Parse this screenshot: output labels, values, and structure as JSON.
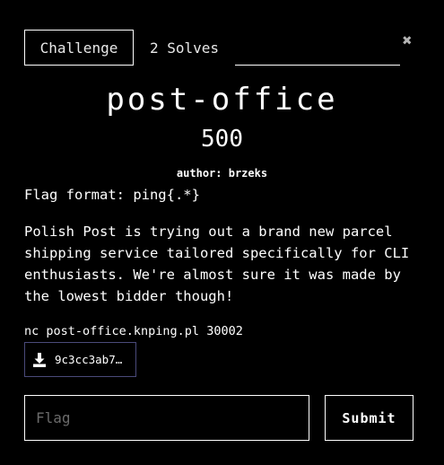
{
  "tabs": [
    {
      "label": "Challenge",
      "active": true
    },
    {
      "label": "2 Solves",
      "active": false
    }
  ],
  "close_icon": "close-icon",
  "challenge": {
    "title": "post-office",
    "points": "500",
    "author": "author: brzeks",
    "flag_format": "Flag format: ping{.*}",
    "description": "Polish Post is trying out a brand new parcel shipping service tailored specifically for CLI enthusiasts. We're almost sure it was made by the lowest bidder though!",
    "connection": "nc post-office.knping.pl 30002"
  },
  "file": {
    "label": "9c3cc3ab7…",
    "icon": "download-icon"
  },
  "form": {
    "flag_placeholder": "Flag",
    "flag_value": "",
    "submit_label": "Submit"
  },
  "colors": {
    "background": "#000000",
    "text": "#ffffff",
    "file_border": "#4a4a7a",
    "placeholder": "#6b6b6b"
  }
}
